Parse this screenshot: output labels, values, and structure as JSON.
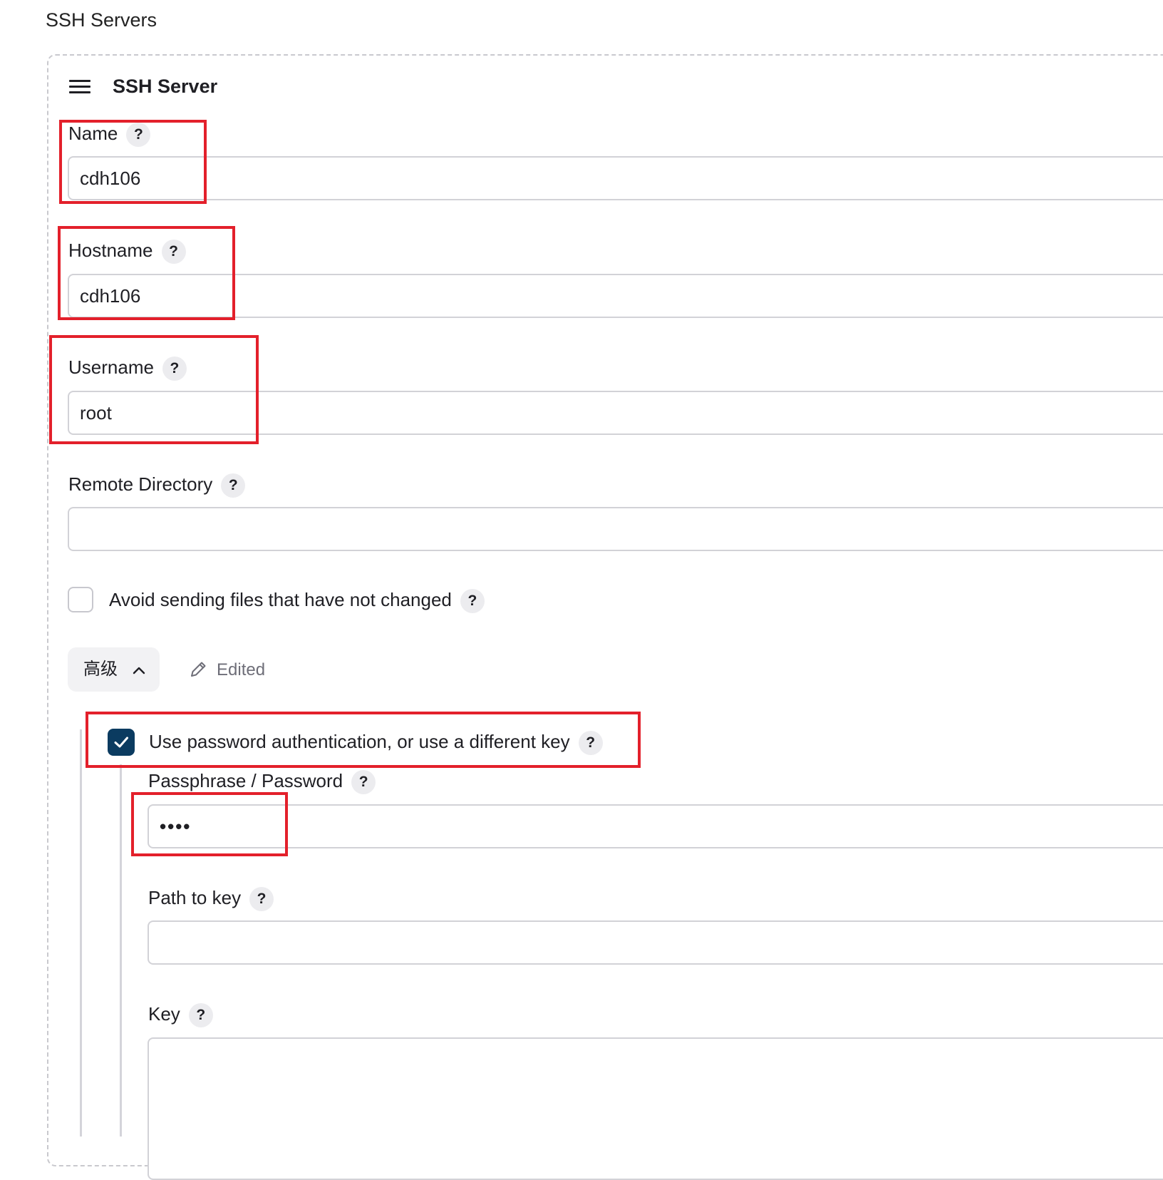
{
  "section": {
    "title": "SSH Servers"
  },
  "server": {
    "title": "SSH Server",
    "help_glyph": "?",
    "fields": {
      "name": {
        "label": "Name",
        "value": "cdh106"
      },
      "hostname": {
        "label": "Hostname",
        "value": "cdh106"
      },
      "username": {
        "label": "Username",
        "value": "root"
      },
      "remote_directory": {
        "label": "Remote Directory",
        "value": ""
      }
    },
    "avoid_sending": {
      "label": "Avoid sending files that have not changed",
      "checked": false
    },
    "advanced": {
      "button_label": "高级",
      "edited_label": "Edited",
      "use_password": {
        "label": "Use password authentication, or use a different key",
        "checked": true
      },
      "passphrase": {
        "label": "Passphrase / Password",
        "value": "••••"
      },
      "path_to_key": {
        "label": "Path to key",
        "value": ""
      },
      "key": {
        "label": "Key",
        "value": ""
      }
    }
  },
  "colors": {
    "highlight_box": "#e3202b",
    "checkbox_checked": "#0b3b60",
    "input_border": "#d2d2d7"
  }
}
